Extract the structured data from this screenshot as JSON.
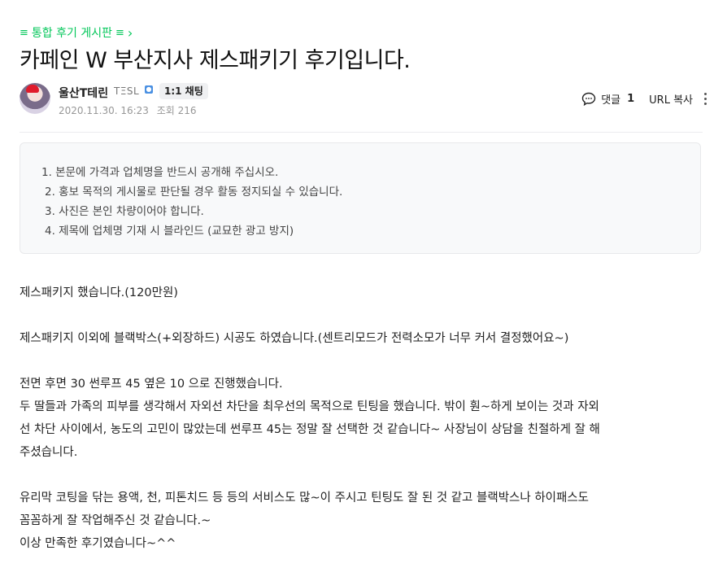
{
  "breadcrumb": {
    "prefix_icon": "≡",
    "label": "통합 후기 게시판",
    "menu_icon": "≡",
    "chevron_icon": "›"
  },
  "post": {
    "title": "카페인 W 부산지사 제스패키기 후기입니다."
  },
  "author": {
    "name": "울산T테린",
    "level": "TΞSL",
    "badge_icon": "verified-icon",
    "chat_label": "1:1 채팅",
    "date": "2020.11.30. 16:23",
    "views_label": "조회 216"
  },
  "actions": {
    "comment_label": "댓글",
    "comment_count": "1",
    "url_copy_label": "URL 복사"
  },
  "notice": {
    "items": [
      "1. 본문에 가격과 업체명을 반드시 공개해 주십시오.",
      "2. 홍보 목적의 게시물로 판단될 경우 활동 정지되실 수 있습니다.",
      "3. 사진은 본인 차량이어야 합니다.",
      "4. 제목에 업체명 기재 시 블라인드 (교묘한 광고 방지)"
    ]
  },
  "content": {
    "p1": "제스패키지 했습니다.(120만원)",
    "p2": "제스패키지 이외에 블랙박스(+외장하드) 시공도 하였습니다.(센트리모드가 전력소모가 너무 커서 결정했어요~)",
    "p3": "전면 후면 30 썬루프 45 옆은 10 으로 진행했습니다.",
    "p4a": "두 딸들과 가족의 피부를 생각해서 자외선 차단을 최우선의 목적으로 틴팅을 했습니다. 밖이 훤~하게 보이는 것과 자외",
    "p4b": "선 차단 사이에서, 농도의 고민이 많았는데 썬루프 45는 정말 잘 선택한 것 같습니다~ 사장님이 상담을 친절하게 잘 해",
    "p4c": "주셨습니다.",
    "p5a": "유리막 코팅을 닦는 용액, 천, 피톤치드 등 등의 서비스도 많~이 주시고 틴팅도 잘 된 것 같고 블랙박스나 하이패스도",
    "p5b": "꼼꼼하게 잘 작업해주신 것 같습니다.~",
    "p6": "이상 만족한 후기였습니다~^^"
  },
  "colors": {
    "accent": "#03c75a",
    "text": "#222222",
    "muted": "#979797",
    "notice_bg": "#f8f9fa"
  }
}
